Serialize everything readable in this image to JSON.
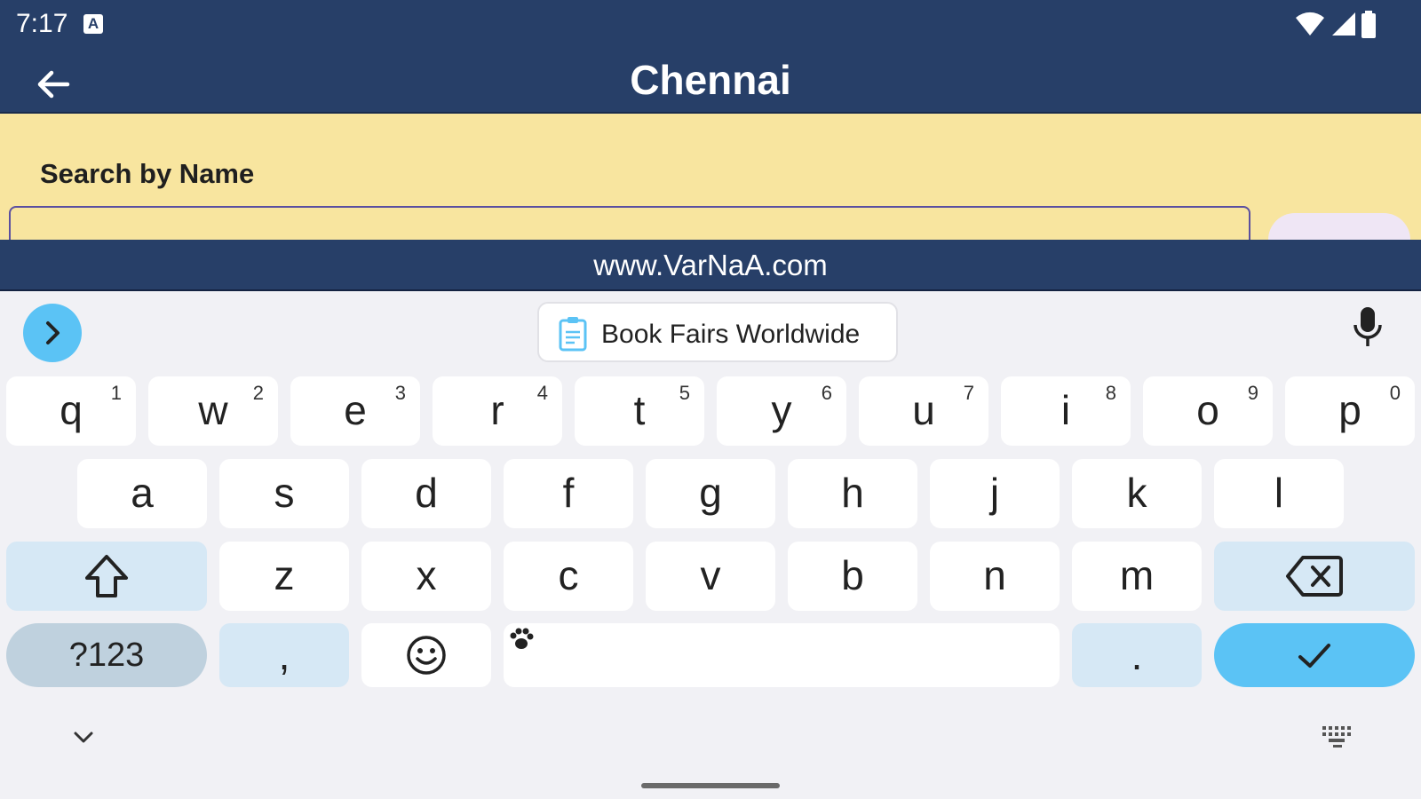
{
  "status_bar": {
    "time": "7:17",
    "notification_badge": "A",
    "icons": [
      "wifi-icon",
      "signal-icon",
      "battery-icon"
    ]
  },
  "app_bar": {
    "title": "Chennai",
    "back_icon": "arrow-left-icon"
  },
  "search": {
    "label": "Search by Name",
    "input_value": "",
    "placeholder": ""
  },
  "footer": {
    "url": "www.VarNaA.com"
  },
  "keyboard": {
    "suggestion_chip": "Book Fairs Worldwide",
    "row1": [
      {
        "key": "q",
        "sup": "1"
      },
      {
        "key": "w",
        "sup": "2"
      },
      {
        "key": "e",
        "sup": "3"
      },
      {
        "key": "r",
        "sup": "4"
      },
      {
        "key": "t",
        "sup": "5"
      },
      {
        "key": "y",
        "sup": "6"
      },
      {
        "key": "u",
        "sup": "7"
      },
      {
        "key": "i",
        "sup": "8"
      },
      {
        "key": "o",
        "sup": "9"
      },
      {
        "key": "p",
        "sup": "0"
      }
    ],
    "row2": [
      "a",
      "s",
      "d",
      "f",
      "g",
      "h",
      "j",
      "k",
      "l"
    ],
    "row3": [
      "z",
      "x",
      "c",
      "v",
      "b",
      "n",
      "m"
    ],
    "symbols_label": "?123",
    "comma_label": ",",
    "period_label": "."
  },
  "colors": {
    "app_bar": "#273f68",
    "search_area": "#f8e59f",
    "accent": "#5bc3f5",
    "modifier_key": "#d6e8f5"
  }
}
